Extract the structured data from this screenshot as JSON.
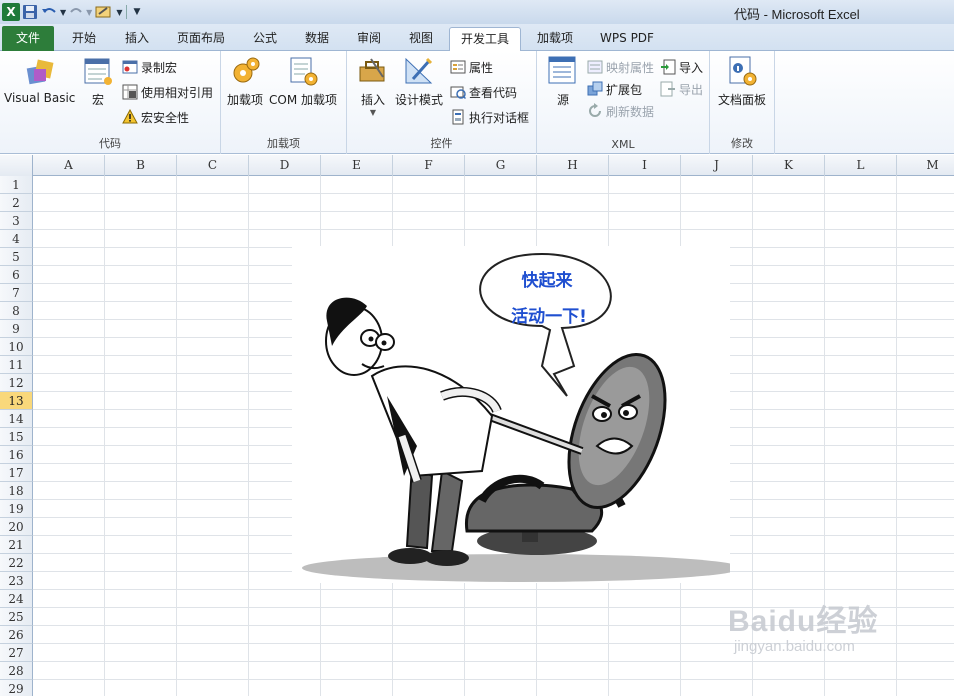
{
  "window": {
    "title": "代码 - Microsoft Excel"
  },
  "quick_access": {
    "icons": [
      "excel-logo-icon",
      "save-icon",
      "undo-icon",
      "redo-icon",
      "tools-icon",
      "customize-icon"
    ]
  },
  "tabs": [
    {
      "label": "文件",
      "type": "file"
    },
    {
      "label": "开始"
    },
    {
      "label": "插入"
    },
    {
      "label": "页面布局"
    },
    {
      "label": "公式"
    },
    {
      "label": "数据"
    },
    {
      "label": "审阅"
    },
    {
      "label": "视图"
    },
    {
      "label": "开发工具",
      "active": true
    },
    {
      "label": "加载项"
    },
    {
      "label": "WPS PDF"
    }
  ],
  "ribbon": {
    "code": {
      "label": "代码",
      "visual_basic": "Visual Basic",
      "macros": "宏",
      "record_macro": "录制宏",
      "relative_ref": "使用相对引用",
      "macro_security": "宏安全性"
    },
    "addins": {
      "label": "加载项",
      "addins_btn": "加载项",
      "com_addins": "COM 加载项"
    },
    "controls": {
      "label": "控件",
      "insert": "插入",
      "design_mode": "设计模式",
      "properties": "属性",
      "view_code": "查看代码",
      "run_dialog": "执行对话框"
    },
    "xml": {
      "label": "XML",
      "source": "源",
      "map_properties": "映射属性",
      "expansion_packs": "扩展包",
      "refresh_data": "刷新数据",
      "import": "导入",
      "export": "导出"
    },
    "modify": {
      "label": "修改",
      "doc_panel": "文档面板"
    }
  },
  "sheet": {
    "columns": [
      "A",
      "B",
      "C",
      "D",
      "E",
      "F",
      "G",
      "H",
      "I",
      "J",
      "K",
      "L",
      "M"
    ],
    "rows": [
      "1",
      "2",
      "3",
      "4",
      "5",
      "6",
      "7",
      "8",
      "9",
      "10",
      "11",
      "12",
      "13",
      "14",
      "15",
      "16",
      "17",
      "18",
      "19",
      "20",
      "21",
      "22",
      "23",
      "24",
      "25",
      "26",
      "27",
      "28",
      "29"
    ],
    "selected_row": "13"
  },
  "picture": {
    "bubble_line1": "快起来",
    "bubble_line2": "活动一下!"
  },
  "watermark": {
    "main": "Baidu经验",
    "sub": "jingyan.baidu.com"
  }
}
